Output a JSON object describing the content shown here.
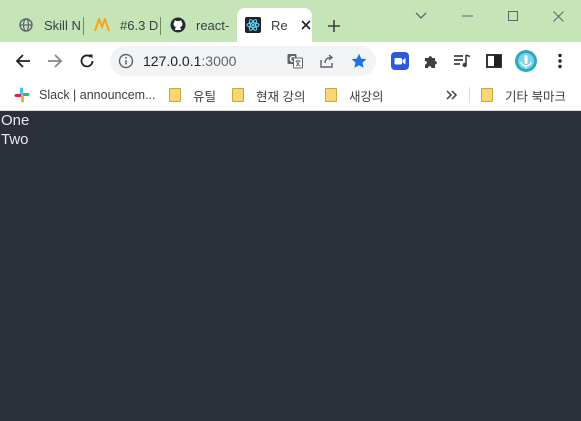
{
  "tabs": [
    {
      "title": "Skill N",
      "favicon": "globe-icon",
      "active": false
    },
    {
      "title": "#6.3 D",
      "favicon": "nomad-logo-icon",
      "active": false
    },
    {
      "title": "react-",
      "favicon": "github-icon",
      "active": false
    },
    {
      "title": "Re",
      "favicon": "react-icon",
      "active": true
    }
  ],
  "address": {
    "host": "127.0.0.1",
    "port": ":3000"
  },
  "bookmarks": [
    {
      "label": "Slack | announcem...",
      "icon": "slack-icon"
    },
    {
      "label": "유틸",
      "icon": "folder-icon"
    },
    {
      "label": "현재 강의",
      "icon": "folder-icon"
    },
    {
      "label": "새강의",
      "icon": "folder-icon"
    }
  ],
  "other_bookmarks": {
    "label": "기타 북마크",
    "icon": "folder-icon"
  },
  "page_lines": [
    "One",
    "Two"
  ],
  "colors": {
    "tabstrip": "#c5e5b9",
    "page_background": "#2b303b",
    "page_text": "#e8eaed",
    "accent": "#1a73e8"
  }
}
